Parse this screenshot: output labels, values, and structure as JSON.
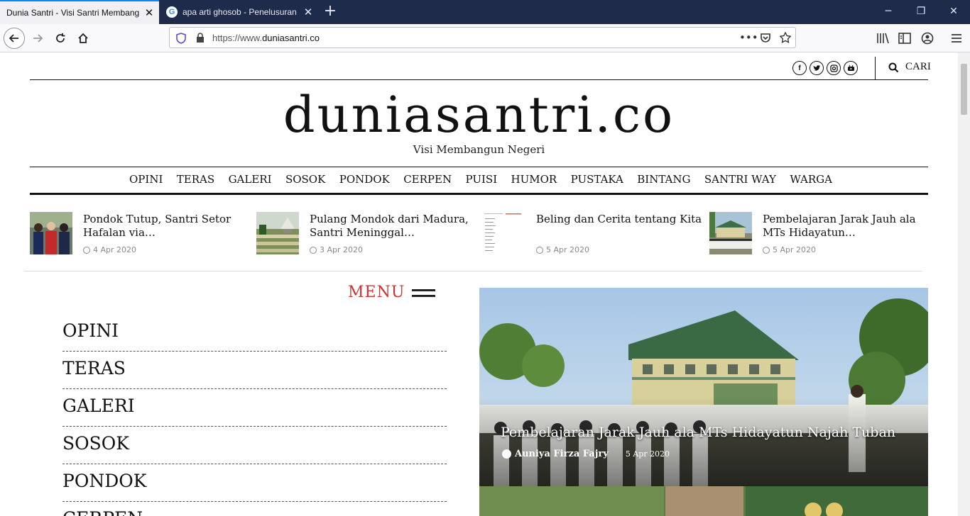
{
  "browser": {
    "tabs": [
      {
        "title": "Dunia Santri - Visi Santri Membangun Negeri",
        "active": true
      },
      {
        "title": "apa arti ghosob - Penelusuran Google",
        "active": false
      }
    ],
    "url_prefix": "https://www.",
    "url_domain": "duniasantri.co"
  },
  "header": {
    "social_icons": [
      "facebook-icon",
      "twitter-icon",
      "instagram-icon",
      "youtube-icon"
    ],
    "search_label": "CARI"
  },
  "site": {
    "logo": "duniasantri.co",
    "tagline": "Visi Membangun Negeri"
  },
  "nav": [
    "OPINI",
    "TERAS",
    "GALERI",
    "SOSOK",
    "PONDOK",
    "CERPEN",
    "PUISI",
    "HUMOR",
    "PUSTAKA",
    "BINTANG",
    "SANTRI WAY",
    "WARGA"
  ],
  "trending": [
    {
      "title": "Pondok Tutup, Santri Setor Hafalan via…",
      "date": "4 Apr 2020"
    },
    {
      "title": "Pulang Mondok dari Madura, Santri Meninggal…",
      "date": "3 Apr 2020"
    },
    {
      "title": "Beling dan Cerita tentang Kita",
      "date": "5 Apr 2020"
    },
    {
      "title": "Pembelajaran Jarak Jauh ala MTs Hidayatun…",
      "date": "5 Apr 2020"
    }
  ],
  "side_menu": {
    "heading": "MENU",
    "items": [
      "OPINI",
      "TERAS",
      "GALERI",
      "SOSOK",
      "PONDOK",
      "CERPEN"
    ]
  },
  "featured": {
    "title": "Pembelajaran Jarak Jauh ala MTs Hidayatun Najah Tuban",
    "author": "Auniya Firza Fajry",
    "date": "5 Apr 2020"
  },
  "colors": {
    "tabbar": "#1e2b4a",
    "menu_heading": "#d23030",
    "accent_blue": "#0a84ff"
  }
}
